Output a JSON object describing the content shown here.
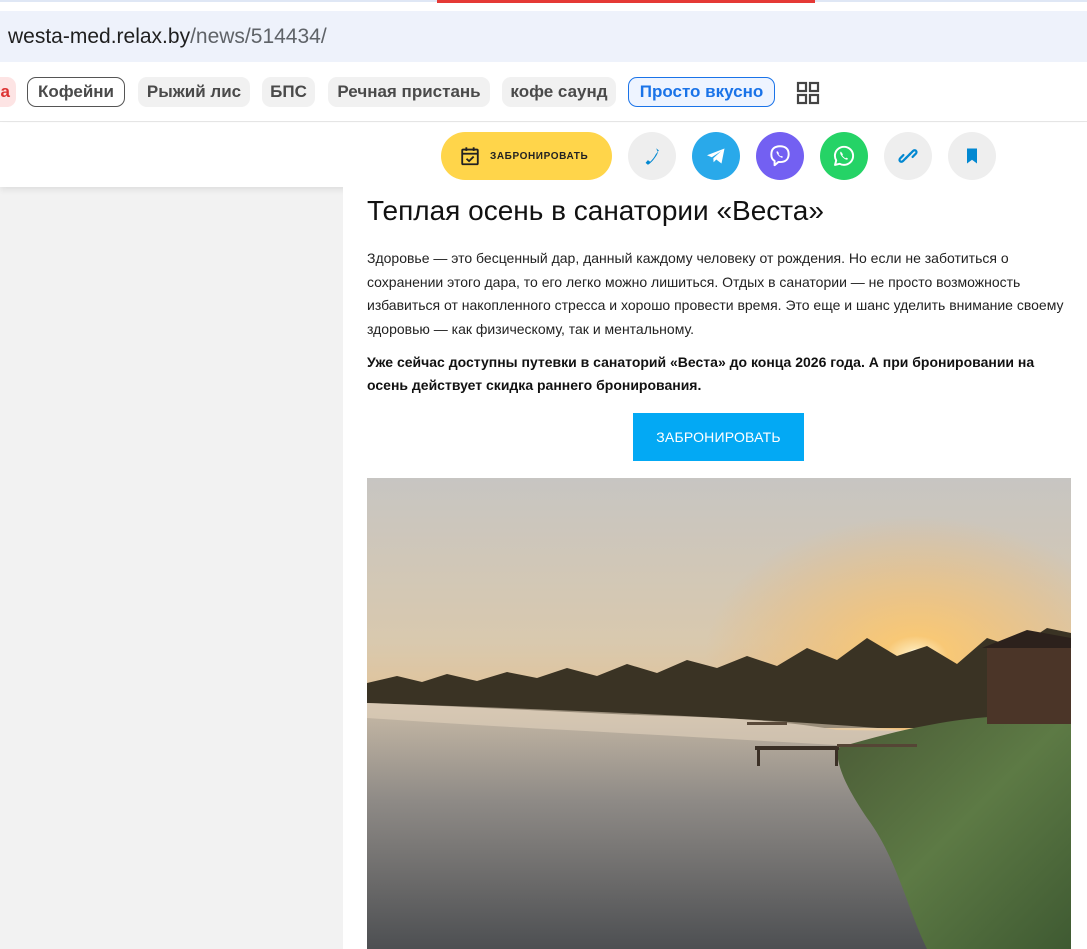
{
  "browser": {
    "url_host": "westa-med.relax.by",
    "url_path": "/news/514434/"
  },
  "chips": {
    "partial": "а",
    "items": [
      "Кофейни",
      "Рыжий лис",
      "БПС",
      "Речная пристань",
      "кофе саунд",
      "Просто вкусно"
    ]
  },
  "action_bar": {
    "book_label": "ЗАБРОНИРОВАТЬ",
    "icons": [
      "calendar-check-icon",
      "phone-icon",
      "telegram-icon",
      "viber-icon",
      "whatsapp-icon",
      "link-icon",
      "bookmark-icon"
    ]
  },
  "article": {
    "title": "Теплая осень в санатории «Веста»",
    "intro": "Здоровье — это бесценный дар, данный каждому человеку от рождения. Но если не заботиться о сохранении этого дара, то его легко можно лишиться. Отдых в санатории — не просто возможность избавиться от накопленного стресса и хорошо провести время. Это еще и шанс уделить внимание своему здоровью — как физическому, так и ментальному.",
    "highlight": "Уже сейчас доступны путевки в санаторий «Веста» до конца 2026 года. А при бронировании на осень действует скидка раннего бронирования.",
    "cta_label": "ЗАБРОНИРОВАТЬ"
  },
  "colors": {
    "accent_yellow": "#ffd54a",
    "cta_blue": "#03a9f4",
    "telegram": "#29a9ea",
    "viber": "#7360f2",
    "whatsapp": "#25d366",
    "active_chip": "#1a73e8"
  }
}
